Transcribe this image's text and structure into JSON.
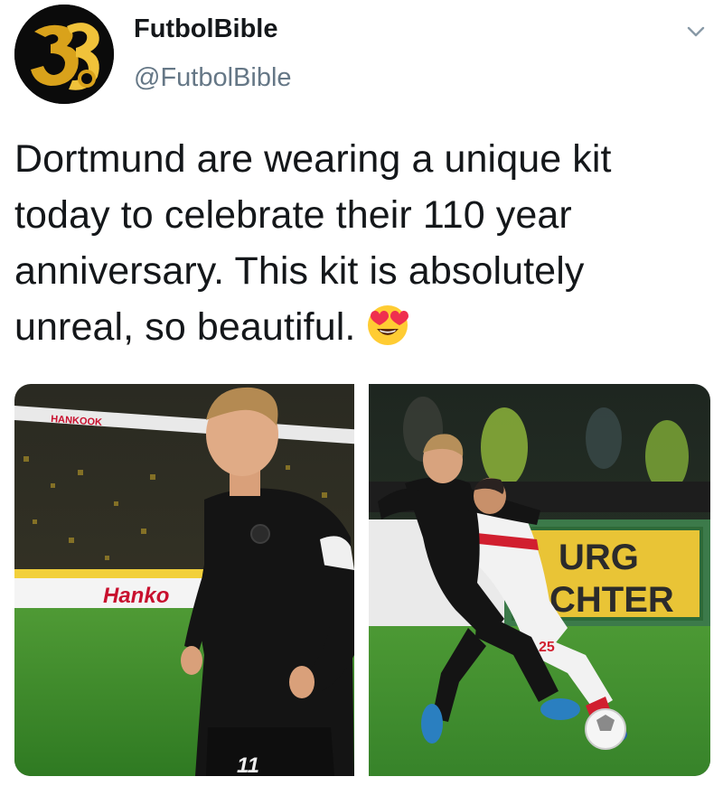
{
  "tweet": {
    "author": {
      "name": "FutbolBible",
      "handle": "@FutbolBible",
      "avatar_icon": "futbolbible-logo"
    },
    "menu_icon": "chevron-down-icon",
    "text": "Dortmund are wearing a unique kit today to celebrate their 110 year anniversary. This kit is absolutely unreal, so beautiful.",
    "emoji": "heart-eyes-emoji",
    "media": [
      {
        "kind": "photo",
        "description_icon": "player-photo",
        "board_text": [
          "HANKOOK",
          "Hanko"
        ],
        "shirt_number": "11"
      },
      {
        "kind": "photo",
        "description_icon": "match-action-photo",
        "board_text": [
          "URG",
          "CHTER"
        ],
        "shirt_number": "25"
      }
    ]
  },
  "colors": {
    "text": "#14171a",
    "secondary_text": "#657786",
    "kit_black": "#141414",
    "pitch_green": "#3d8a2c",
    "avatar_gold": "#d9a21b"
  }
}
